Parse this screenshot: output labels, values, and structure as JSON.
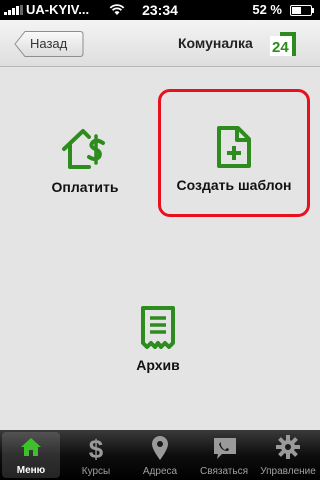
{
  "status_bar": {
    "carrier": "UA-KYIV...",
    "time": "23:34",
    "battery_text": "52 %",
    "battery_level": 0.52
  },
  "nav": {
    "back_label": "Назад",
    "title": "Комуналка",
    "logo_text": "24"
  },
  "tiles": {
    "pay": {
      "label": "Оплатить",
      "icon": "house-dollar-icon"
    },
    "create": {
      "label": "Создать шаблон",
      "icon": "document-plus-icon"
    },
    "archive": {
      "label": "Архив",
      "icon": "archive-receipt-icon"
    }
  },
  "tabs": [
    {
      "label": "Меню",
      "icon": "home-icon",
      "active": true
    },
    {
      "label": "Курсы",
      "icon": "dollar-icon"
    },
    {
      "label": "Адреса",
      "icon": "location-pin-icon"
    },
    {
      "label": "Связаться",
      "icon": "chat-phone-icon"
    },
    {
      "label": "Управление",
      "icon": "gear-icon"
    }
  ],
  "colors": {
    "accent_green": "#2e8b1e",
    "highlight_red": "#e8101c"
  }
}
